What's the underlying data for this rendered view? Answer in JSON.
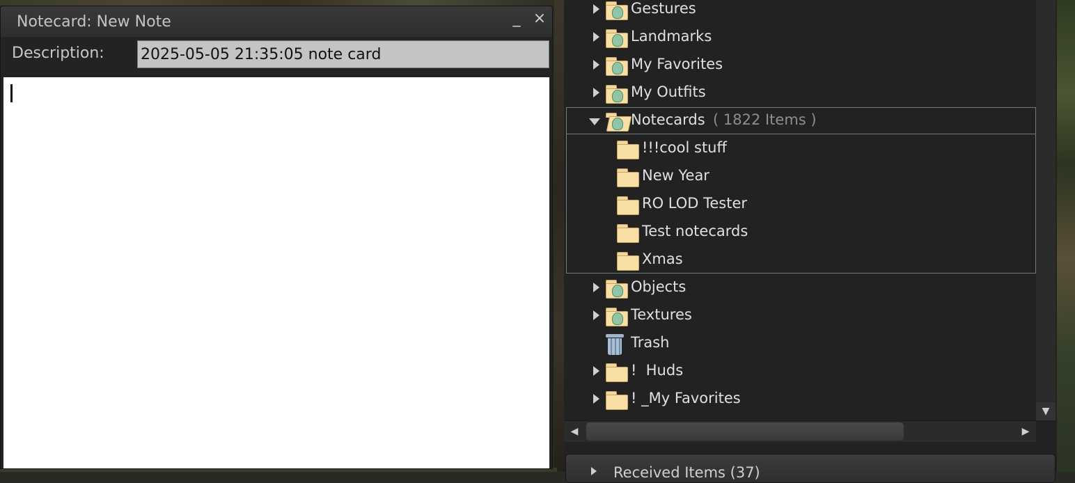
{
  "notecard": {
    "title": "Notecard: New Note",
    "minimize_glyph": "_",
    "close_glyph": "×",
    "description_label": "Description:",
    "description_value": "2025-05-05 21:35:05 note card",
    "body_text": ""
  },
  "inventory": {
    "items": [
      {
        "label": "Gestures",
        "icon": "system-folder-icon",
        "arrow": "collapsed"
      },
      {
        "label": "Landmarks",
        "icon": "system-folder-icon",
        "arrow": "collapsed"
      },
      {
        "label": "My Favorites",
        "icon": "system-folder-icon",
        "arrow": "collapsed"
      },
      {
        "label": "My Outfits",
        "icon": "system-folder-icon",
        "arrow": "collapsed"
      },
      {
        "label": "Notecards",
        "count": "( 1822 Items )",
        "icon": "open-system-folder-icon",
        "arrow": "expanded"
      },
      {
        "label": "!!!cool stuff",
        "icon": "folder-icon"
      },
      {
        "label": "New Year",
        "icon": "folder-icon"
      },
      {
        "label": "RO LOD Tester",
        "icon": "folder-icon"
      },
      {
        "label": "Test notecards",
        "icon": "folder-icon"
      },
      {
        "label": "Xmas",
        "icon": "folder-icon"
      },
      {
        "label": "Objects",
        "icon": "system-folder-icon",
        "arrow": "collapsed"
      },
      {
        "label": "Textures",
        "icon": "system-folder-icon",
        "arrow": "collapsed"
      },
      {
        "label": "Trash",
        "icon": "trash-icon"
      },
      {
        "label": "!  Huds",
        "icon": "folder-icon",
        "arrow": "collapsed"
      },
      {
        "label": "! _My Favorites",
        "icon": "folder-icon",
        "arrow": "collapsed"
      }
    ],
    "received_label": "Received Items (37)"
  },
  "colors": {
    "panel_bg": "#222222",
    "notecard_body": "#ffffff",
    "folder": "#f8dfa5",
    "selection_outline": "#6f7f7a"
  }
}
